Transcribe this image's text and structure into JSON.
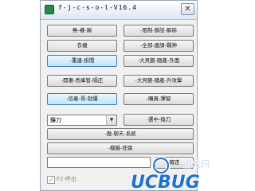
{
  "window": {
    "title": "f-j-c-s-o-l-V16.4",
    "close_glyph": "✕"
  },
  "buttons": {
    "r1_left": "無-襪-踢",
    "r1_right": "-限制-鎖話-解除",
    "r2_left": "衣襪",
    "r2_right": "-全部-邀請-戰神",
    "r3_left": "-重連-掛閒",
    "r3_right": "-大貝變-隨產-升面",
    "r4_left": "-開著-丢庫管-隔庄",
    "r4_right": "-大貝變-隨產-升攻擊",
    "r5_left": "-信春-哥-就爆",
    "r5_right": "-購買-彈窗",
    "r6_right": "-選中-換刀",
    "r7": "-傲-聊天-系統",
    "r8": "-模擬-狂跳",
    "ok": "確定"
  },
  "select": {
    "value": "鐮刀",
    "arrow": "▼"
  },
  "input": {
    "value": ""
  },
  "checkbox": {
    "label": "F2-呼出",
    "checked": true,
    "mark": "✓"
  },
  "watermark": {
    "text": "UCBUG",
    "subtext": "游戏网"
  },
  "colors": {
    "highlight_border": "#3c7fb1",
    "highlight_fill": "#bee6fd",
    "watermark_blue": "#1f6fd0"
  }
}
